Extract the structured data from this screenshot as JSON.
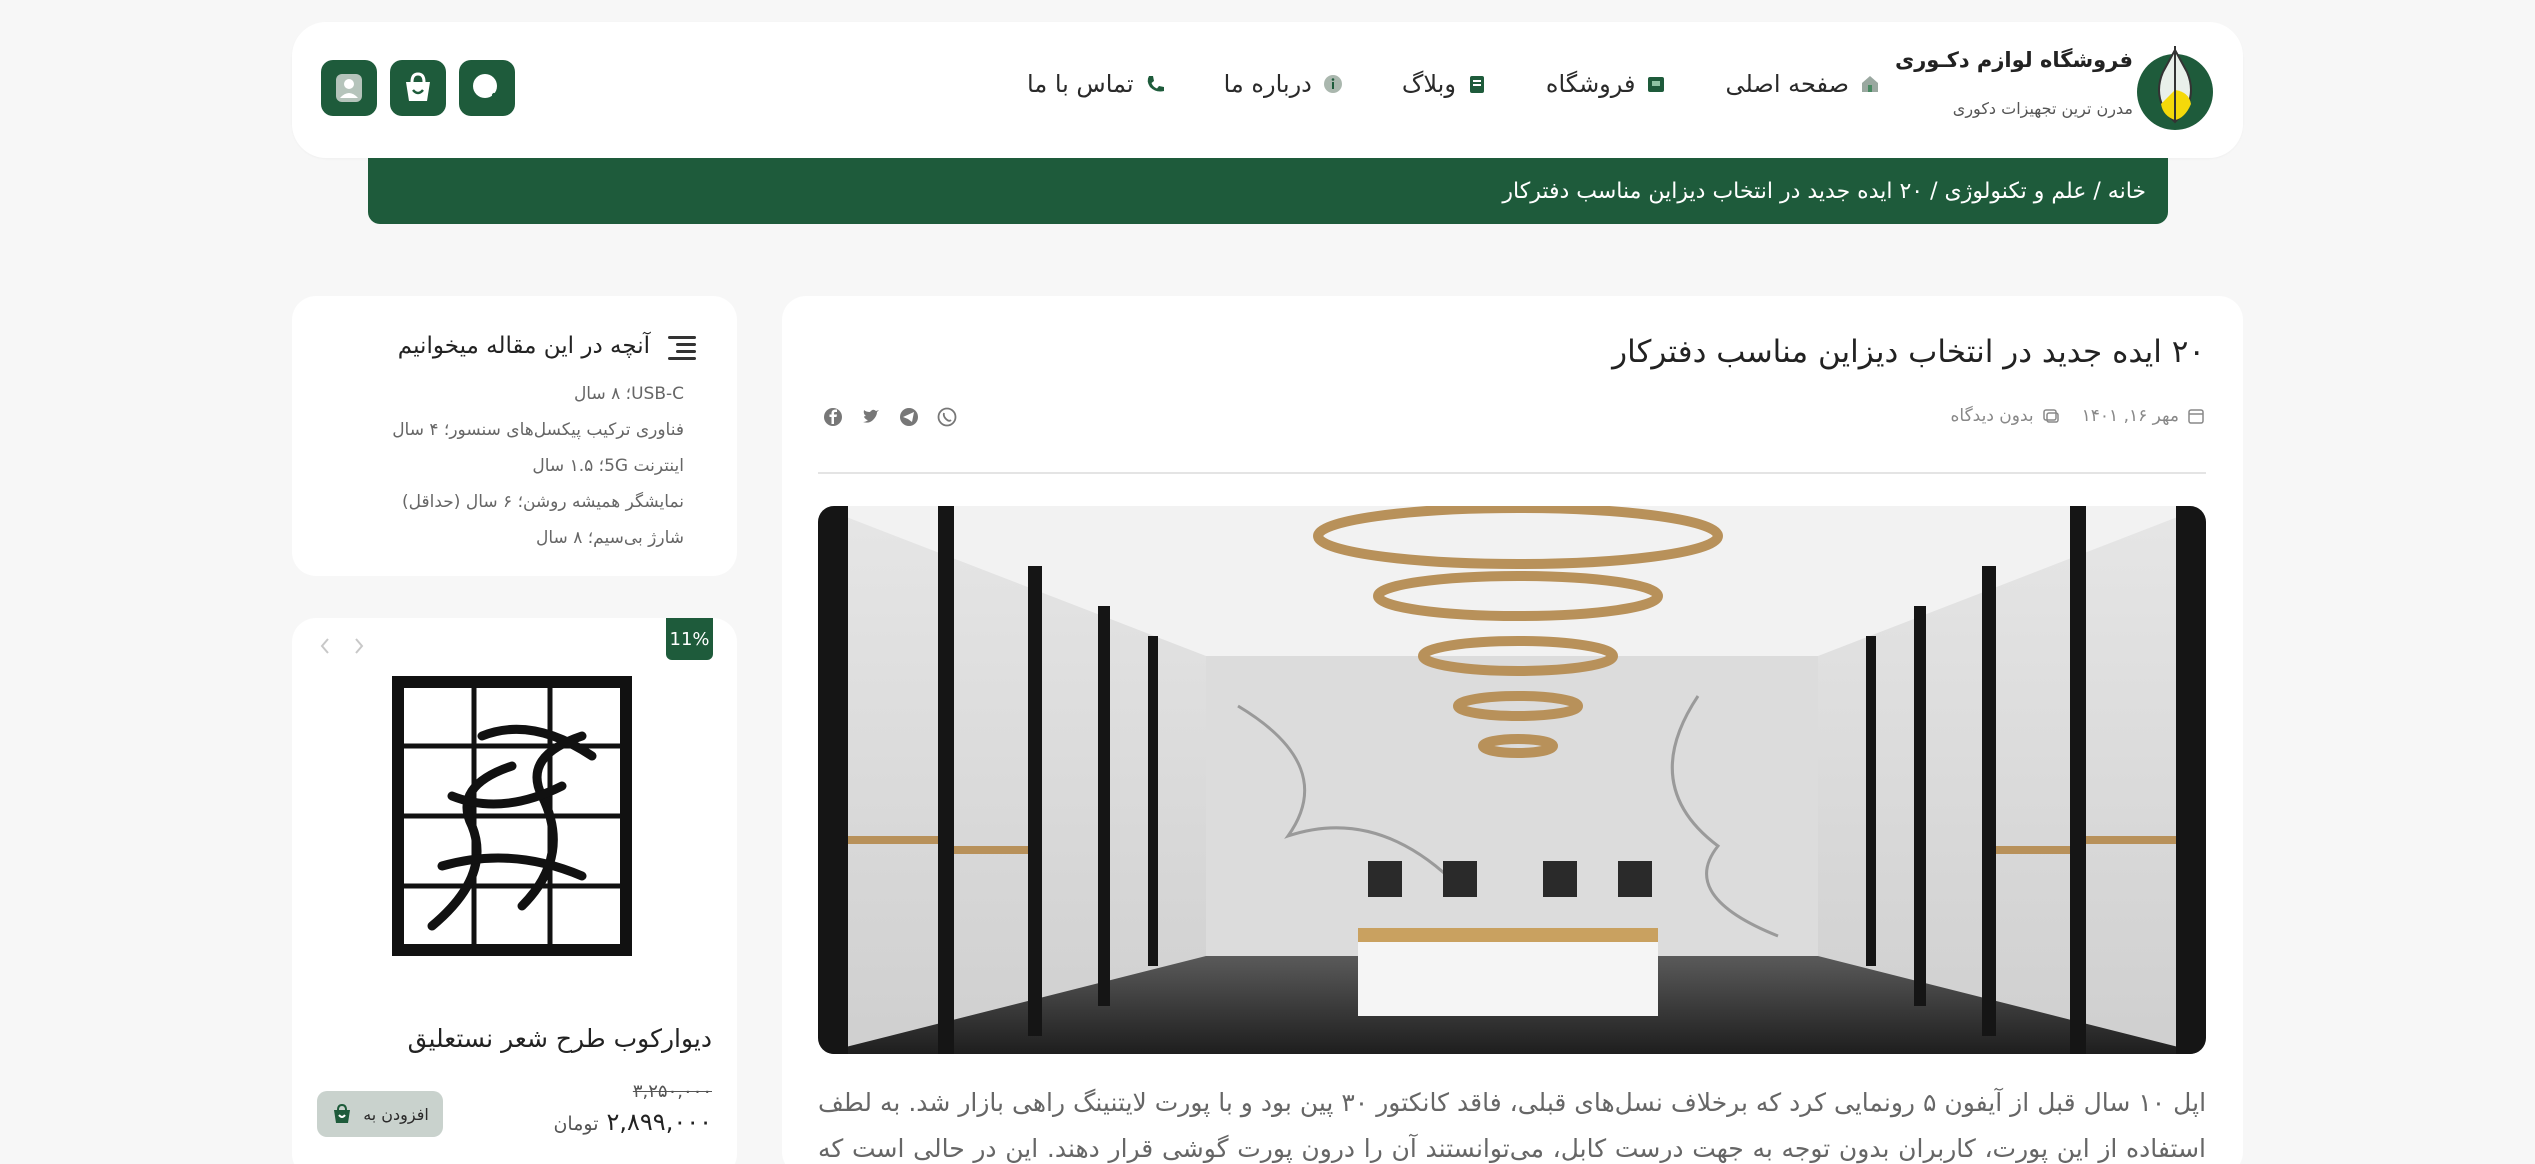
{
  "brand": {
    "name": "فروشگاه لوازم دکـوری",
    "tagline": "مدرن ترین تجهیزات دکوری"
  },
  "nav": {
    "items": [
      {
        "label": "صفحه اصلی",
        "icon": "home-icon"
      },
      {
        "label": "فروشگاه",
        "icon": "shop-icon"
      },
      {
        "label": "وبلاگ",
        "icon": "blog-icon"
      },
      {
        "label": "درباره ما",
        "icon": "info-icon"
      },
      {
        "label": "تماس با ما",
        "icon": "phone-icon"
      }
    ]
  },
  "header_actions": {
    "search": "search-icon",
    "cart": "cart-icon",
    "account": "user-icon"
  },
  "breadcrumb": {
    "text": "خانه / علم و تکنولوژی / ۲۰ ایده جدید در انتخاب دیزاین مناسب دفترکار"
  },
  "article": {
    "title": "۲۰ ایده جدید در انتخاب دیزاین مناسب دفترکار",
    "date": "مهر ۱۶, ۱۴۰۱",
    "comments": "بدون دیدگاه",
    "share_icons": [
      "facebook-icon",
      "twitter-icon",
      "telegram-icon",
      "whatsapp-icon"
    ],
    "body": "اپل ۱۰ سال قبل از آیفون ۵ رونمایی کرد که برخلاف نسل‌های قبلی، فاقد کانکتور ۳۰ پین بود و با پورت لایتنینگ راهی بازار شد. به لطف استفاده از این پورت، کاربران بدون توجه به جهت درست کابل، می‌توانستند آن را درون پورت گوشی قرار دهند. این در حالی است که پیش از لایتنینگ، برای سایر"
  },
  "toc": {
    "title": "آنچه در این مقاله میخوانیم",
    "items": [
      "USB-C؛ ۸ سال",
      "فناوری ترکیب پیکسل‌های سنسور؛ ۴ سال",
      "اینترنت 5G؛ ۱.۵ سال",
      "نمایشگر همیشه روشن؛ ۶ سال (حداقل)",
      "شارژ بی‌سیم؛ ۸ سال"
    ]
  },
  "product": {
    "discount": "11%",
    "name": "دیوارکوب طرح شعر نستعلیق",
    "old_price": "۳,۲۵۰,۰۰۰",
    "new_price": "۲,۸۹۹,۰۰۰",
    "currency": "تومان",
    "add_to_cart": "افزودن به"
  },
  "colors": {
    "brand_green": "#1e5b3b",
    "background": "#f7f7f7"
  }
}
